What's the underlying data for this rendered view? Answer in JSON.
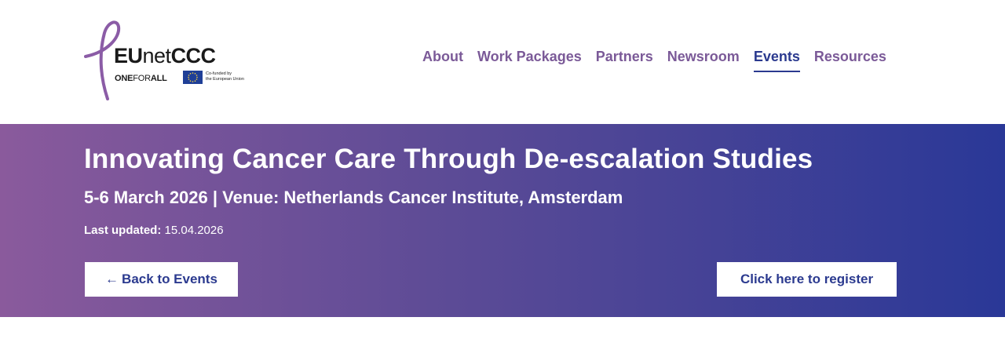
{
  "logo": {
    "word_main": "EU",
    "word_net": "net",
    "word_end": "CCC",
    "tag_one": "ONE",
    "tag_for": "FOR",
    "tag_all": "ALL",
    "eu_line1": "Co-funded by",
    "eu_line2": "the European Union"
  },
  "nav": {
    "items": [
      {
        "label": "About"
      },
      {
        "label": "Work Packages"
      },
      {
        "label": "Partners"
      },
      {
        "label": "Newsroom"
      },
      {
        "label": "Events"
      },
      {
        "label": "Resources"
      }
    ],
    "active": "Events"
  },
  "banner": {
    "title": "Innovating Cancer Care Through De-escalation Studies",
    "subtitle": "5-6 March 2026 | Venue: Netherlands Cancer Institute, Amsterdam",
    "updated_label": "Last updated:",
    "updated_value": "15.04.2026"
  },
  "buttons": {
    "back_arrow": "←",
    "back_label": "Back to Events",
    "register_label": "Click here to register"
  },
  "colors": {
    "brand_purple": "#7b5a98",
    "brand_navy": "#2b3a8f",
    "gradient_start": "#8a5a9c",
    "gradient_end": "#2a3897"
  }
}
